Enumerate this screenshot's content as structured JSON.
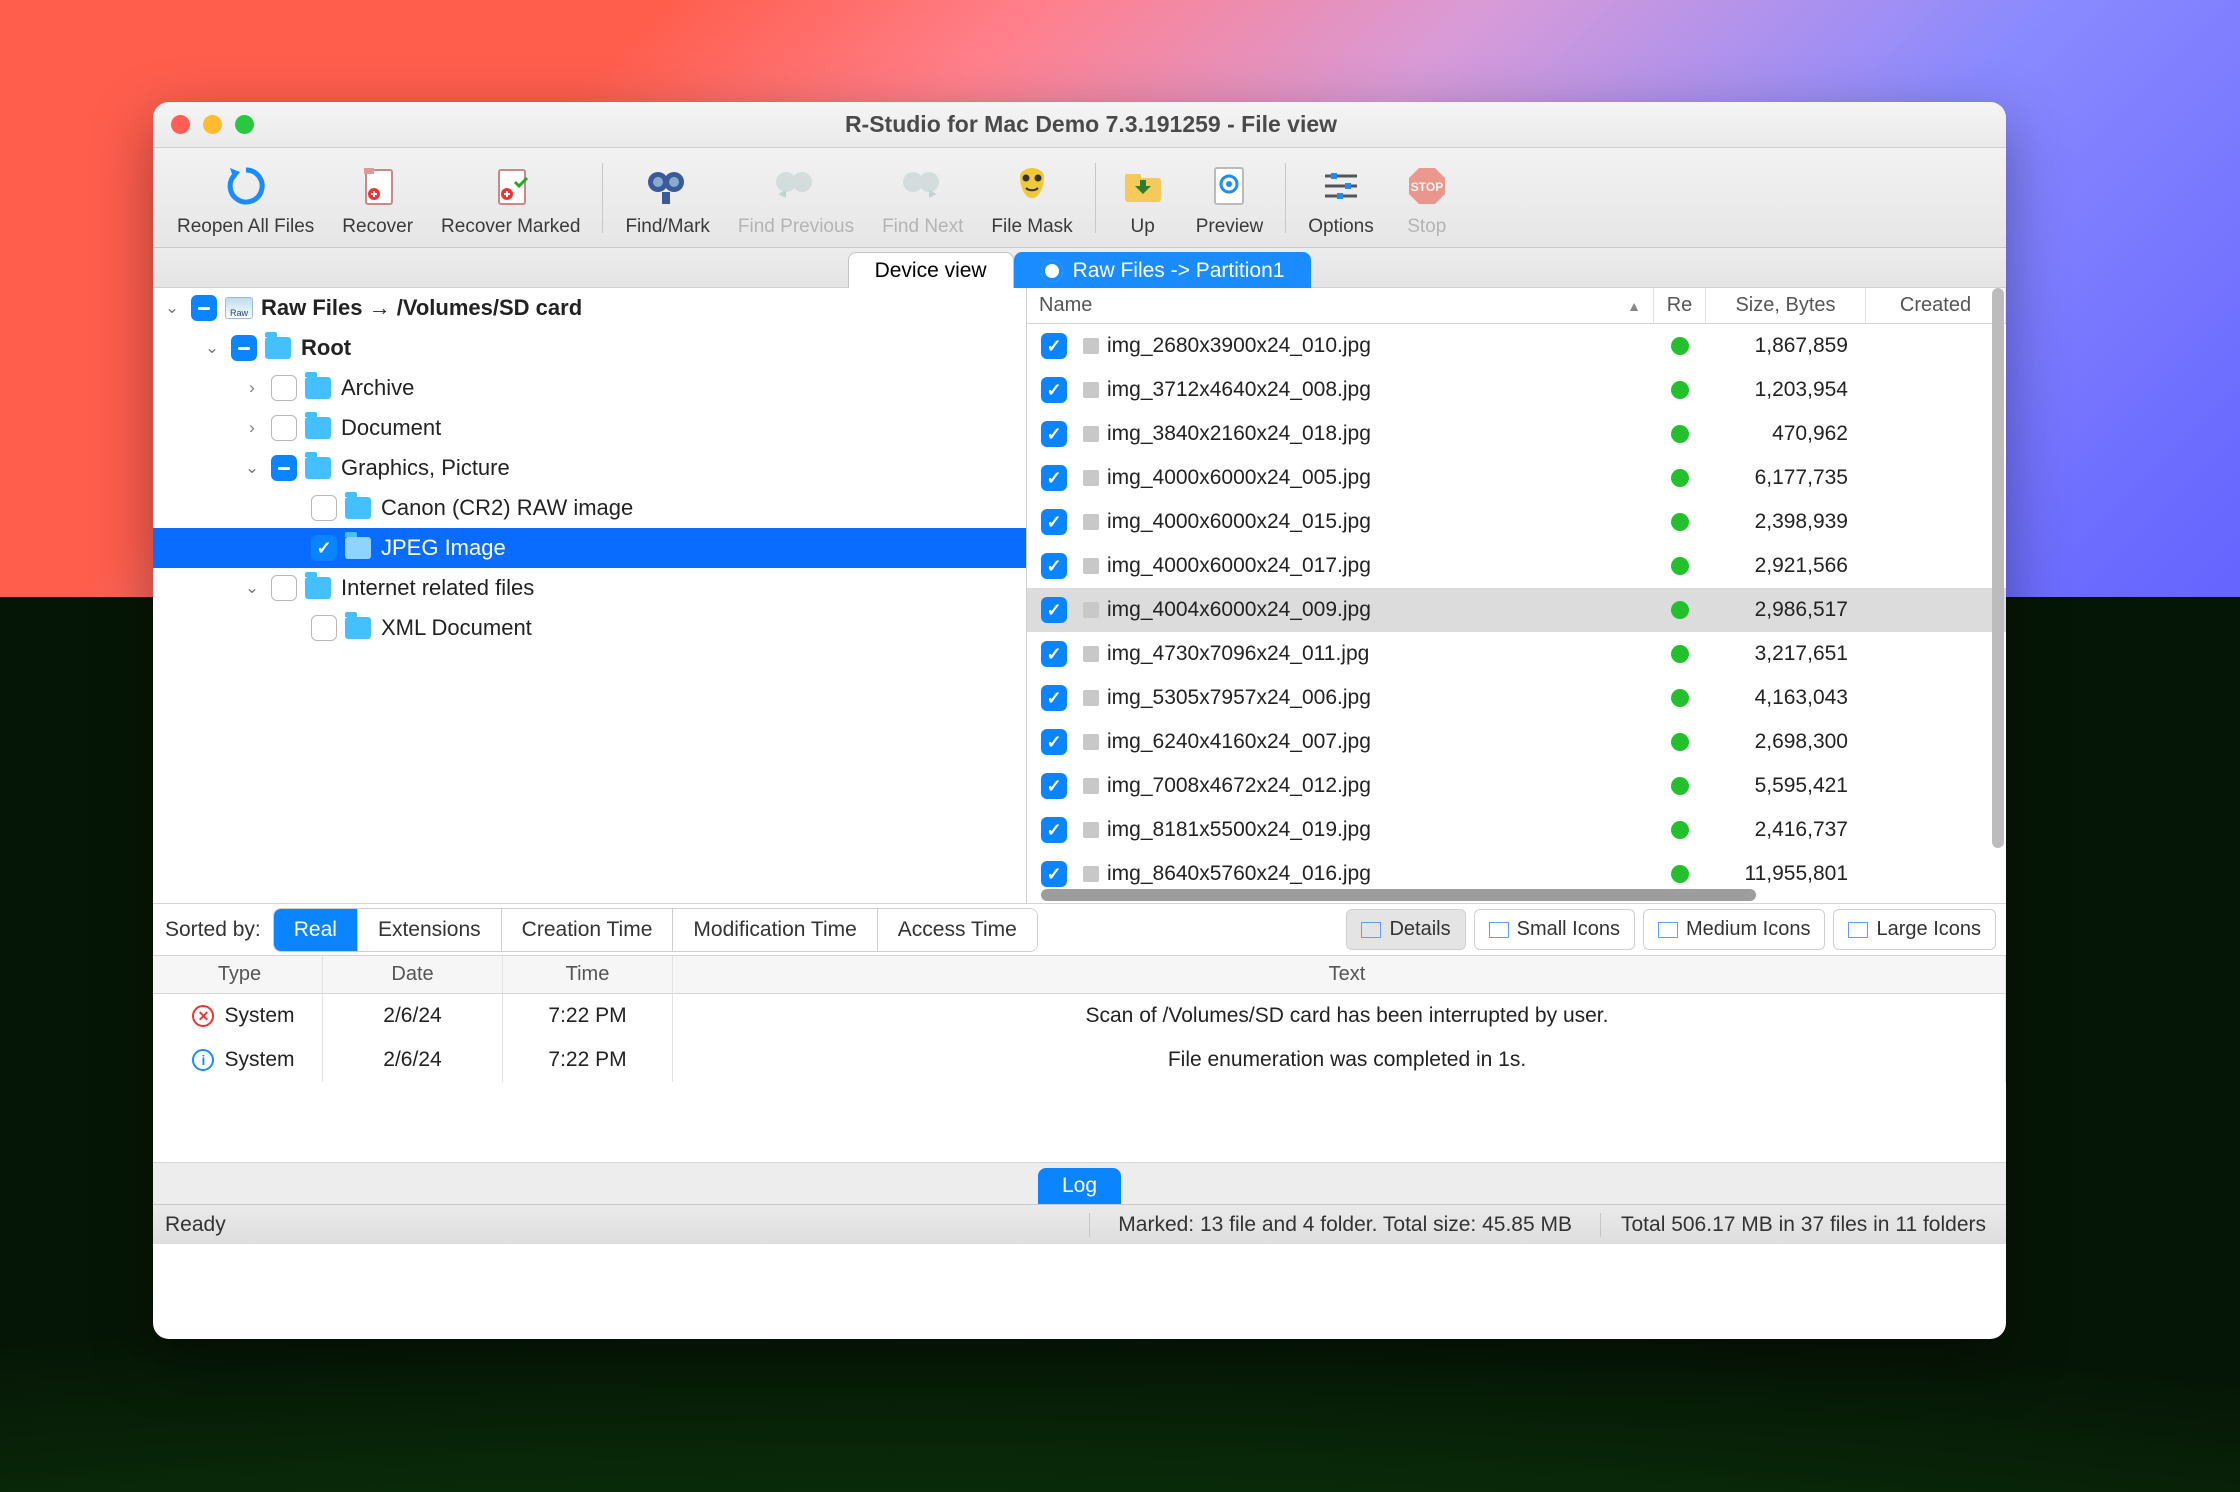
{
  "window": {
    "title": "R-Studio for Mac Demo 7.3.191259 - File view"
  },
  "toolbar": [
    {
      "id": "reopen",
      "label": "Reopen All Files",
      "enabled": true
    },
    {
      "id": "recover",
      "label": "Recover",
      "enabled": true
    },
    {
      "id": "recover-marked",
      "label": "Recover Marked",
      "enabled": true
    },
    {
      "sep": true
    },
    {
      "id": "find-mark",
      "label": "Find/Mark",
      "enabled": true
    },
    {
      "id": "find-prev",
      "label": "Find Previous",
      "enabled": false
    },
    {
      "id": "find-next",
      "label": "Find Next",
      "enabled": false
    },
    {
      "id": "file-mask",
      "label": "File Mask",
      "enabled": true
    },
    {
      "sep": true
    },
    {
      "id": "up",
      "label": "Up",
      "enabled": true
    },
    {
      "id": "preview",
      "label": "Preview",
      "enabled": true
    },
    {
      "sep": true
    },
    {
      "id": "options",
      "label": "Options",
      "enabled": true
    },
    {
      "id": "stop",
      "label": "Stop",
      "enabled": false
    }
  ],
  "tabs": {
    "device": "Device view",
    "raw": "Raw Files -> Partition1"
  },
  "tree": {
    "root_label": "Raw Files → /Volumes/SD card",
    "items": [
      {
        "label": "Root",
        "depth": 1,
        "arrow": "down",
        "chk": "mixed",
        "bold": true
      },
      {
        "label": "Archive",
        "depth": 2,
        "arrow": "right",
        "chk": "none"
      },
      {
        "label": "Document",
        "depth": 2,
        "arrow": "right",
        "chk": "none"
      },
      {
        "label": "Graphics, Picture",
        "depth": 2,
        "arrow": "down",
        "chk": "mixed"
      },
      {
        "label": "Canon (CR2) RAW image",
        "depth": 3,
        "arrow": "",
        "chk": "none"
      },
      {
        "label": "JPEG Image",
        "depth": 3,
        "arrow": "",
        "chk": "checked",
        "selected": true
      },
      {
        "label": "Internet related files",
        "depth": 2,
        "arrow": "down",
        "chk": "none"
      },
      {
        "label": "XML Document",
        "depth": 3,
        "arrow": "",
        "chk": "none"
      }
    ]
  },
  "filelist": {
    "headers": {
      "name": "Name",
      "re": "Re",
      "size": "Size, Bytes",
      "created": "Created"
    },
    "rows": [
      {
        "name": "img_2680x3900x24_010.jpg",
        "size": "1,867,859"
      },
      {
        "name": "img_3712x4640x24_008.jpg",
        "size": "1,203,954"
      },
      {
        "name": "img_3840x2160x24_018.jpg",
        "size": "470,962"
      },
      {
        "name": "img_4000x6000x24_005.jpg",
        "size": "6,177,735"
      },
      {
        "name": "img_4000x6000x24_015.jpg",
        "size": "2,398,939"
      },
      {
        "name": "img_4000x6000x24_017.jpg",
        "size": "2,921,566"
      },
      {
        "name": "img_4004x6000x24_009.jpg",
        "size": "2,986,517",
        "selected": true
      },
      {
        "name": "img_4730x7096x24_011.jpg",
        "size": "3,217,651"
      },
      {
        "name": "img_5305x7957x24_006.jpg",
        "size": "4,163,043"
      },
      {
        "name": "img_6240x4160x24_007.jpg",
        "size": "2,698,300"
      },
      {
        "name": "img_7008x4672x24_012.jpg",
        "size": "5,595,421"
      },
      {
        "name": "img_8181x5500x24_019.jpg",
        "size": "2,416,737"
      },
      {
        "name": "img_8640x5760x24_016.jpg",
        "size": "11,955,801"
      }
    ]
  },
  "sortbar": {
    "label": "Sorted by:",
    "options": [
      "Real",
      "Extensions",
      "Creation Time",
      "Modification Time",
      "Access Time"
    ],
    "active": "Real",
    "views": [
      "Details",
      "Small Icons",
      "Medium Icons",
      "Large Icons"
    ],
    "view_active": "Details"
  },
  "log": {
    "headers": {
      "type": "Type",
      "date": "Date",
      "time": "Time",
      "text": "Text"
    },
    "rows": [
      {
        "kind": "err",
        "type": "System",
        "date": "2/6/24",
        "time": "7:22 PM",
        "text": "Scan of /Volumes/SD card has been interrupted by user."
      },
      {
        "kind": "info",
        "type": "System",
        "date": "2/6/24",
        "time": "7:22 PM",
        "text": "File enumeration was completed in 1s."
      }
    ],
    "tab": "Log"
  },
  "status": {
    "ready": "Ready",
    "marked": "Marked: 13 file and 4 folder. Total size: 45.85 MB",
    "total": "Total 506.17 MB in 37 files in 11 folders"
  }
}
